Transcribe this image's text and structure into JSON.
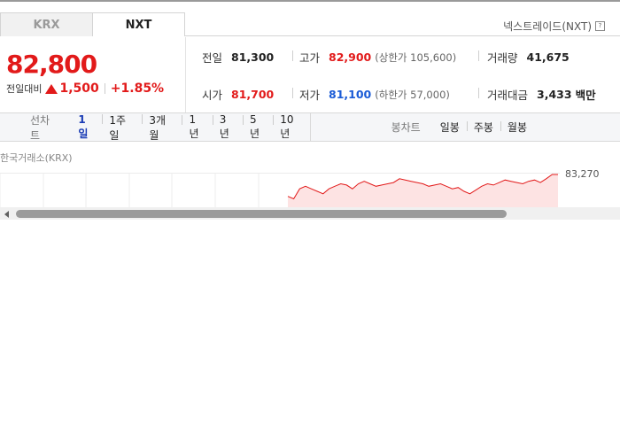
{
  "tabs": [
    {
      "label": "KRX",
      "active": false
    },
    {
      "label": "NXT",
      "active": true
    }
  ],
  "header": {
    "nxt_title": "넥스트레이드(NXT)",
    "help_icon": "?"
  },
  "quote": {
    "price": "82,800",
    "change_label": "전일대비",
    "change_amount": "1,500",
    "change_percent": "+1.85%"
  },
  "stats": {
    "prev_close": {
      "label": "전일",
      "value": "81,300"
    },
    "open": {
      "label": "시가",
      "value": "81,700"
    },
    "high": {
      "label": "고가",
      "value": "82,900",
      "limit": "(상한가 105,600)"
    },
    "low": {
      "label": "저가",
      "value": "81,100",
      "limit": "(하한가 57,000)"
    },
    "volume": {
      "label": "거래량",
      "value": "41,675"
    },
    "amount": {
      "label": "거래대금",
      "value": "3,433",
      "unit": "백만"
    }
  },
  "line_chart_nav": {
    "title": "선차트",
    "periods": [
      "1일",
      "1주일",
      "3개월",
      "1년",
      "3년",
      "5년",
      "10년"
    ],
    "selected": "1일"
  },
  "candle_chart_nav": {
    "title": "봉차트",
    "periods": [
      "일봉",
      "주봉",
      "월봉"
    ]
  },
  "chart": {
    "exchange_label": "한국거래소(KRX)",
    "max_label": "83,270"
  },
  "colors": {
    "up": "#e21a1a",
    "down": "#1a5bd6",
    "selected_period": "#1a3cb5"
  },
  "chart_data": {
    "type": "line",
    "y_max_label": 83270,
    "values": [
      82400,
      82300,
      82700,
      82800,
      82700,
      82600,
      82500,
      82700,
      82800,
      82900,
      82850,
      82700,
      82900,
      83000,
      82900,
      82800,
      82850,
      82900,
      82950,
      83100,
      83050,
      83000,
      82950,
      82900,
      82800,
      82850,
      82900,
      82800,
      82700,
      82750,
      82600,
      82500,
      82650,
      82800,
      82900,
      82850,
      82950,
      83050,
      83000,
      82950,
      82900,
      83000,
      83050,
      82950,
      83100,
      83270,
      83270
    ]
  }
}
